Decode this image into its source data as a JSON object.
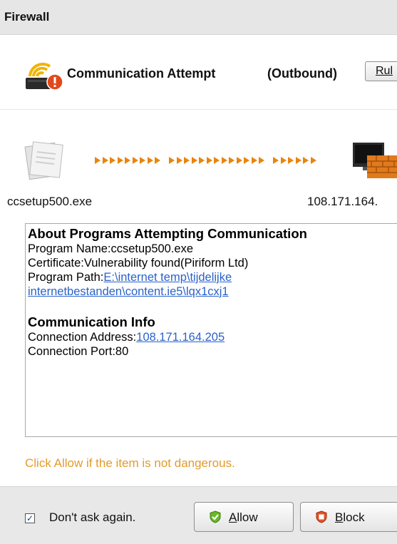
{
  "window": {
    "title": "Firewall"
  },
  "header": {
    "title": "Communication Attempt",
    "direction": "(Outbound)",
    "rules_button_label": "Rul"
  },
  "flow": {
    "program_name": "ccsetup500.exe",
    "remote_address": "108.171.164."
  },
  "info": {
    "programs_heading": "About Programs Attempting Communication",
    "program_name_label": "Program Name:",
    "program_name_value": "ccsetup500.exe",
    "certificate_label": "Certificate:",
    "certificate_value": "Vulnerability found(Piriform Ltd)",
    "path_label": "Program Path:",
    "path_line1": "E:\\internet temp\\tijdelijke",
    "path_line2": "internetbestanden\\content.ie5\\lqx1cxj1",
    "comm_heading": "Communication Info",
    "address_label": "Connection Address:",
    "address_value": "108.171.164.205",
    "port_label": "Connection Port:",
    "port_value": "80"
  },
  "hint": "Click Allow if the item is not dangerous.",
  "footer": {
    "dont_ask_label": "Don't ask again.",
    "dont_ask_checked": true,
    "allow_label_mnemonic": "A",
    "allow_label_rest": "llow",
    "block_label_mnemonic": "B",
    "block_label_rest": "lock"
  },
  "colors": {
    "accent_orange": "#e8850f",
    "hint_text": "#e39b2a",
    "link": "#2a62c9"
  },
  "icons": [
    "wifi-warning-icon",
    "program-file-icon",
    "arrow-icon",
    "network-firewall-icon",
    "checkbox-check-icon",
    "shield-check-icon",
    "shield-block-icon"
  ]
}
